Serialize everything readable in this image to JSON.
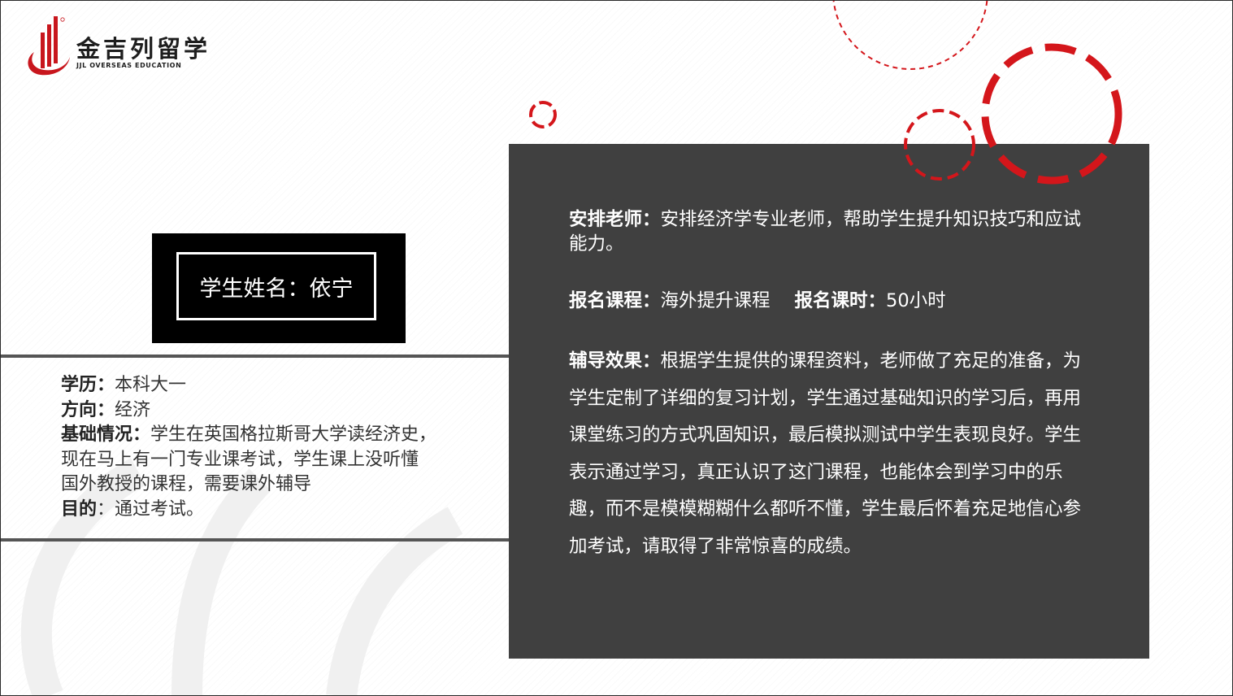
{
  "brand": {
    "name_cn": "金吉列留学",
    "name_en": "JJL OVERSEAS EDUCATION",
    "color": "#c8161d"
  },
  "student": {
    "name_label": "学生姓名：依宁"
  },
  "info": {
    "education_label": "学历：",
    "education_value": "本科大一",
    "direction_label": "方向：",
    "direction_value": "经济",
    "background_label": "基础情况：",
    "background_line1": "学生在英国格拉斯哥大学读经济史，",
    "background_line2": "现在马上有一门专业课考试，学生课上没听懂",
    "background_line3": "国外教授的课程，需要课外辅导",
    "goal_label": "目的",
    "goal_value": "：通过考试。"
  },
  "panel": {
    "teacher_label": "安排老师：",
    "teacher_value": "安排经济学专业老师，帮助学生提升知识技巧和应试能力。",
    "course_label": "报名课程：",
    "course_value": "海外提升课程",
    "hours_label": "报名课时：",
    "hours_value": "50小时",
    "effect_label": "辅导效果：",
    "effect_value": "根据学生提供的课程资料，老师做了充足的准备，为学生定制了详细的复习计划，学生通过基础知识的学习后，再用课堂练习的方式巩固知识，最后模拟测试中学生表现良好。学生表示通过学习，真正认识了这门课程，也能体会到学习中的乐趣，而不是模模糊糊什么都听不懂，学生最后怀着充足地信心参加考试，请取得了非常惊喜的成绩。"
  },
  "colors": {
    "accent_red": "#d4161b",
    "panel_bg": "#404040",
    "name_box_bg": "#000000"
  }
}
